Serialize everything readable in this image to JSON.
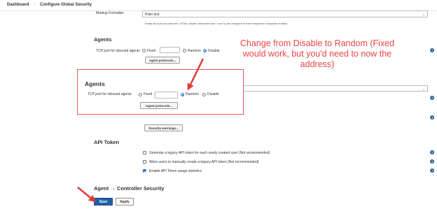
{
  "breadcrumb": {
    "items": [
      "Dashboard",
      "Configure Global Security"
    ],
    "separator": "›"
  },
  "markup": {
    "label": "Markup Formatter",
    "value": "Plain text",
    "hint": "Treats all input as plain text. HTML unsafe characters like < and & are escaped to their respective character entities."
  },
  "agents": {
    "title": "Agents",
    "port_label": "TCP port for inbound agents",
    "options": [
      "Fixed :",
      "Random",
      "Disable"
    ],
    "selected": "Disable",
    "protocols_button": "Agent protocols..."
  },
  "agents_callout": {
    "title": "Agents",
    "port_label": "TCP port for inbound agents",
    "options": [
      "Fixed :",
      "Random",
      "Disable"
    ],
    "selected": "Random",
    "protocols_button": "Agent protocols..."
  },
  "annotation": {
    "text": "Change from Disable to Random (Fixed would work, but you'd need to now the address)",
    "color": "#e84545"
  },
  "security_warnings": {
    "button": "Security warnings..."
  },
  "api_token": {
    "title": "API Token",
    "options": [
      {
        "label": "Generate a legacy API token for each newly created user (Not recommended)",
        "checked": false
      },
      {
        "label": "Allow users to manually create a legacy API token (Not recommended)",
        "checked": false
      },
      {
        "label": "Enable API Token usage statistics",
        "checked": true
      }
    ]
  },
  "agent_controller": {
    "title": "Agent → Controller Security"
  },
  "footer": {
    "save": "Save",
    "apply": "Apply"
  },
  "icons": {
    "help": "?",
    "caret": "⌄"
  },
  "colors": {
    "primary": "#1f5fa8",
    "callout_border": "#e05c5c",
    "arrow": "#e03a3a",
    "radio_selected": "#2d6ed8"
  }
}
